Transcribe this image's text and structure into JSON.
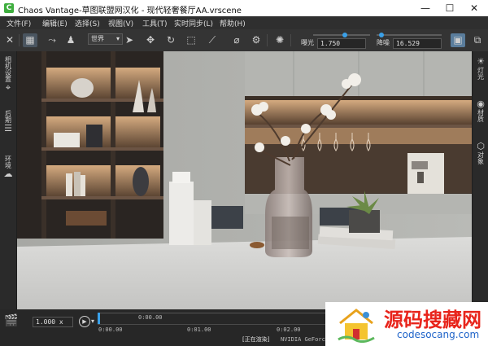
{
  "window": {
    "logo_glyph": "C",
    "title": "Chaos Vantage-草图联盟网汉化 - 现代轻奢餐厅AA.vrscene",
    "minimize_glyph": "—",
    "maximize_glyph": "☐",
    "close_glyph": "✕"
  },
  "menu": {
    "items": [
      "文件(F)",
      "编辑(E)",
      "选择(S)",
      "视图(V)",
      "工具(T)",
      "实时同步(L)",
      "帮助(H)"
    ]
  },
  "toolbar": {
    "view_mode": "世界",
    "exposure_label": "曝光",
    "exposure_value": "1.750",
    "exposure_fraction": 0.55,
    "denoise_label": "降噪",
    "denoise_value": "16.529",
    "denoise_fraction": 0.08,
    "icons": [
      "selection-mode-icon",
      "camera-icon",
      "walk-icon",
      "person-icon",
      "pointer-icon",
      "move-icon",
      "rotate-icon",
      "scale-icon",
      "path-icon",
      "paint-icon",
      "material-picker-icon",
      "sun-icon",
      "render-icon",
      "settings-icon"
    ]
  },
  "left_panel": {
    "tabs": [
      "相机设置",
      "后期",
      "环境"
    ]
  },
  "right_panel": {
    "tabs": [
      "灯光",
      "材质",
      "对象"
    ]
  },
  "timeline": {
    "zoom_value": "1.000",
    "zoom_unit": "x",
    "top_time": "0:00.00",
    "ticks": [
      "0:00.00",
      "0:01.00",
      "0:02.00"
    ],
    "status": "[正在渲染]",
    "gpu": "NVIDIA GeForc"
  },
  "watermark": {
    "title": "源码搜藏网",
    "url": "codesocang.com"
  }
}
